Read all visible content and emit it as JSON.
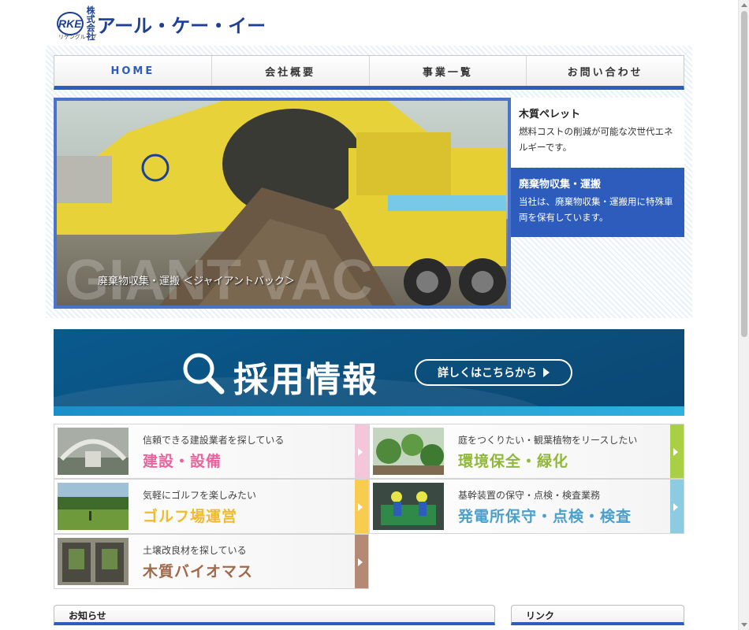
{
  "logo": {
    "mark": "RKE",
    "sub": "リケングループ",
    "kaisha": "株式会社",
    "name": "アール・ケー・イー"
  },
  "nav": {
    "items": [
      {
        "label": "HOME",
        "active": true
      },
      {
        "label": "会社概要",
        "active": false
      },
      {
        "label": "事業一覧",
        "active": false
      },
      {
        "label": "お問い合わせ",
        "active": false
      }
    ]
  },
  "hero": {
    "caption": "廃棄物収集・運搬 ＜ジャイアントバック＞",
    "watermark": "GIANT VAC",
    "side": [
      {
        "title": "木質ペレット",
        "text": "燃料コストの削減が可能な次世代エネルギーです。"
      },
      {
        "title": "廃棄物収集・運搬",
        "text": "当社は、廃棄物収集・運搬用に特殊車両を保有しています。"
      }
    ]
  },
  "recruit": {
    "title": "採用情報",
    "button": "詳しくはこちらから"
  },
  "business": [
    {
      "sub": "信頼できる建設業者を探している",
      "title": "建設・設備",
      "color": "#e8649c",
      "tab": "#f4c6d9"
    },
    {
      "sub": "庭をつくりたい・観葉植物をリースしたい",
      "title": "環境保全・緑化",
      "color": "#8fb83a",
      "tab": "#a9cf45"
    },
    {
      "sub": "気軽にゴルフを楽しみたい",
      "title": "ゴルフ場運営",
      "color": "#f2b92e",
      "tab": "#f7cc4f"
    },
    {
      "sub": "基幹装置の保守・点検・検査業務",
      "title": "発電所保守・点検・検査",
      "color": "#4aa0c8",
      "tab": "#8ccbe0"
    },
    {
      "sub": "土壌改良材を探している",
      "title": "木質バイオマス",
      "color": "#a0684a",
      "tab": "#b58a74"
    }
  ],
  "bottom": {
    "news": "お知らせ",
    "links": "リンク"
  },
  "colors": {
    "brand": "#1d3f97",
    "accent": "#2d5cbd"
  }
}
